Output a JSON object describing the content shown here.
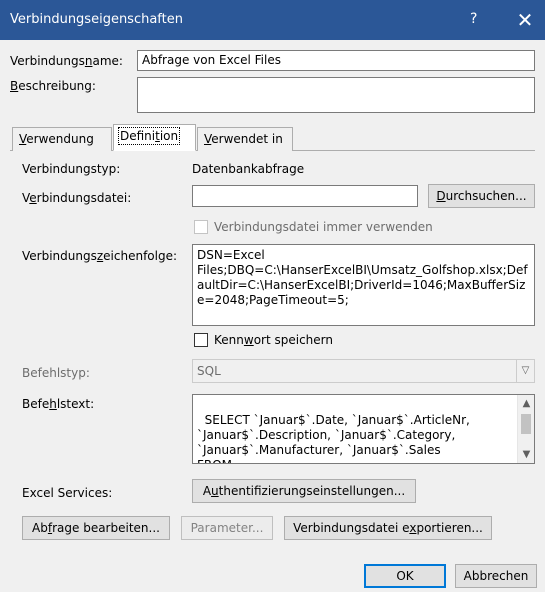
{
  "window": {
    "title": "Verbindungseigenschaften",
    "help": "?",
    "close": "✕"
  },
  "conn_name": {
    "label": "Verbindungsname:",
    "value": "Abfrage von Excel Files"
  },
  "description": {
    "label": "Beschreibung:",
    "value": ""
  },
  "tabs": [
    {
      "label": "Verwendung"
    },
    {
      "label": "Definition"
    },
    {
      "label": "Verwendet in"
    }
  ],
  "conn_type": {
    "label": "Verbindungstyp:",
    "value": "Datenbankabfrage"
  },
  "conn_file": {
    "label": "Verbindungsdatei:",
    "value": "",
    "browse": "Durchsuchen..."
  },
  "always_use": {
    "label": "Verbindungsdatei immer verwenden",
    "checked": false
  },
  "conn_string": {
    "label": "Verbindungszeichenfolge:",
    "value": "DSN=Excel Files;DBQ=C:\\HanserExcelBI\\Umsatz_Golfshop.xlsx;DefaultDir=C:\\HanserExcelBI;DriverId=1046;MaxBufferSize=2048;PageTimeout=5;"
  },
  "save_password": {
    "label": "Kennwort speichern",
    "checked": false
  },
  "command_type": {
    "label": "Befehlstyp:",
    "value": "SQL"
  },
  "command_text": {
    "label": "Befehlstext:",
    "value": "SELECT `Januar$`.Date, `Januar$`.ArticleNr, `Januar$`.Description, `Januar$`.Category, `Januar$`.Manufacturer, `Januar$`.Sales\nFROM `C:\\HanserExcelBI\\Umsatz_Golfshop.xlsx`.`Januar$` `Januar$`"
  },
  "excel_services": {
    "label": "Excel Services:",
    "button": "Authentifizierungseinstellungen..."
  },
  "buttons": {
    "edit_query": "Abfrage bearbeiten...",
    "parameters": "Parameter...",
    "export": "Verbindungsdatei exportieren...",
    "ok": "OK",
    "cancel": "Abbrechen"
  }
}
